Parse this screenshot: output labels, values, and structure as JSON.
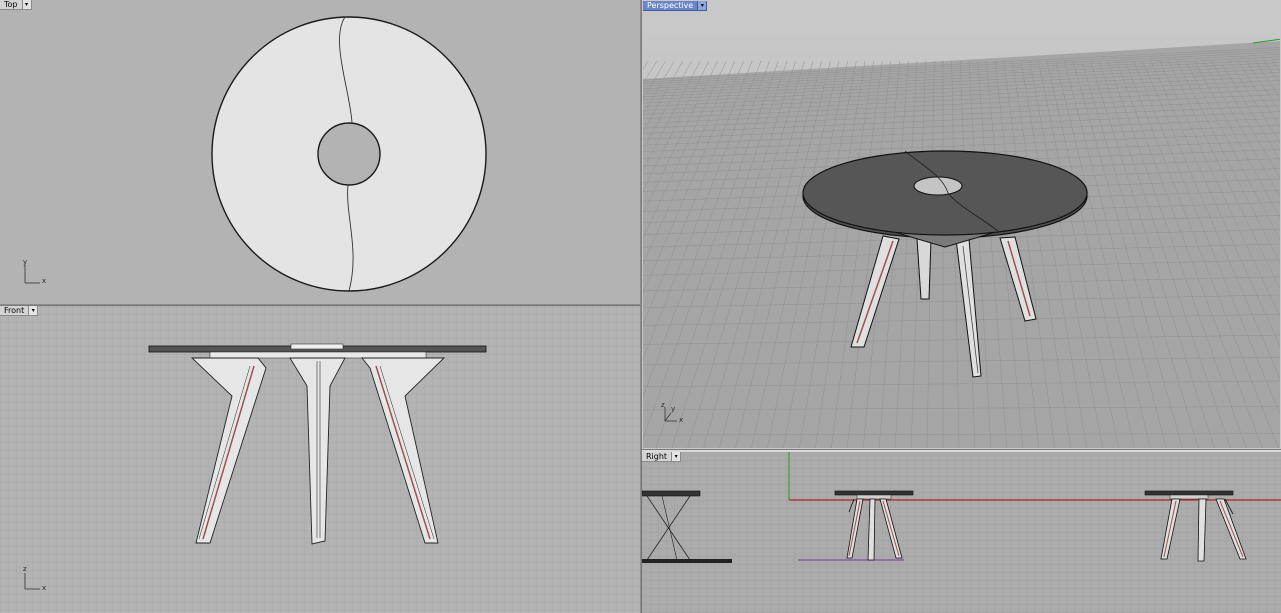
{
  "viewports": {
    "top": {
      "label": "Top",
      "active": false
    },
    "front": {
      "label": "Front",
      "active": false
    },
    "perspective": {
      "label": "Perspective",
      "active": true
    },
    "right": {
      "label": "Right",
      "active": false
    }
  },
  "axes": {
    "top": {
      "vertical": "y",
      "horizontal": "x"
    },
    "front": {
      "vertical": "z",
      "horizontal": "x"
    },
    "perspective": {
      "vertical": "z",
      "horizontal": "x",
      "depth": "y"
    }
  },
  "dropdown_icon": "triangle-down-icon",
  "colors": {
    "viewport_bg": "#b3b3b3",
    "grid_line": "#9e9e9e",
    "active_tab": "#6a86c8",
    "x_axis": "#b40000",
    "z_axis": "#2a9a2a",
    "accent_leg_stripe": "#a05050"
  }
}
